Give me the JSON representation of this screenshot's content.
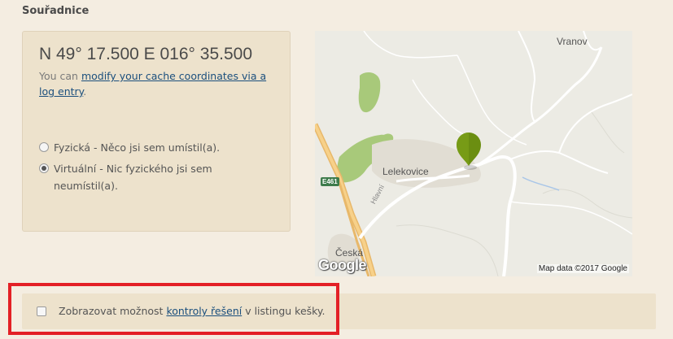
{
  "section": {
    "title": "Souřadnice"
  },
  "coordinates": {
    "text": "N 49° 17.500 E 016° 35.500",
    "modify_prefix": "You can ",
    "modify_link": "modify your cache coordinates via a log entry",
    "modify_suffix": "."
  },
  "options": {
    "physical": {
      "label": "Fyzická - Něco jsi sem umístil(a).",
      "checked": false
    },
    "virtual": {
      "label": "Virtuální - Nic fyzického jsi sem neumístil(a).",
      "checked": true
    }
  },
  "map": {
    "labels": {
      "vranov": "Vranov",
      "lelekovice": "Lelekovice",
      "ceska": "Česká",
      "road": "E461",
      "street": "Hlavní"
    },
    "google_logo": "Google",
    "attribution": "Map data ©2017 Google",
    "marker_color": "#6b8e11"
  },
  "solution_checker": {
    "prefix": "Zobrazovat možnost ",
    "link": "kontroly řešení",
    "suffix": " v listingu kešky.",
    "checked": false
  },
  "colors": {
    "highlight_border": "#e32026",
    "link": "#1b4f7d",
    "panel": "#ede2cc"
  }
}
